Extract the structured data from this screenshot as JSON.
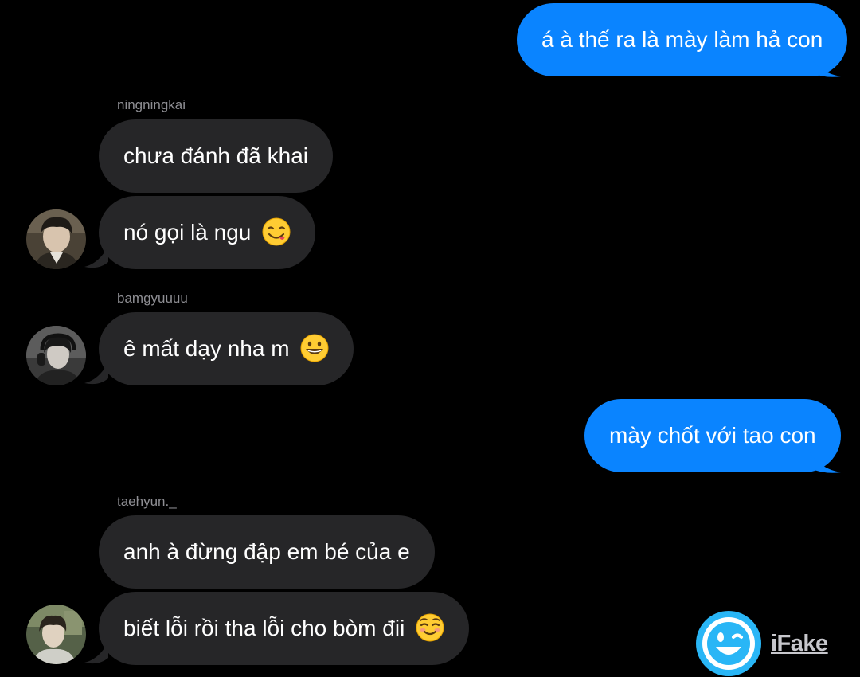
{
  "colors": {
    "background": "#000000",
    "outgoing_bubble": "#0a84ff",
    "incoming_bubble": "#262628",
    "sender_name": "#8e8e93",
    "message_text": "#ffffff"
  },
  "messages": [
    {
      "direction": "outgoing",
      "text": "á à thế ra là mày làm hả con"
    },
    {
      "direction": "incoming",
      "sender": "ningningkai",
      "text": "chưa đánh đã khai"
    },
    {
      "direction": "incoming",
      "sender": "ningningkai",
      "text": "nó gọi là ngu",
      "emoji": "face-savoring-food-icon"
    },
    {
      "direction": "incoming",
      "sender": "bamgyuuuu",
      "text": "ê mất dạy nha m",
      "emoji": "grinning-face-icon"
    },
    {
      "direction": "outgoing",
      "text": "mày chốt với tao con"
    },
    {
      "direction": "incoming",
      "sender": "taehyun._",
      "text": "anh à đừng đập em bé của e"
    },
    {
      "direction": "incoming",
      "sender": "taehyun._",
      "text": "biết lỗi rồi tha lỗi cho bòm đii",
      "emoji": "smiling-face-icon"
    }
  ],
  "watermark": {
    "text": "iFake",
    "icon": "winking-face-logo-icon"
  }
}
